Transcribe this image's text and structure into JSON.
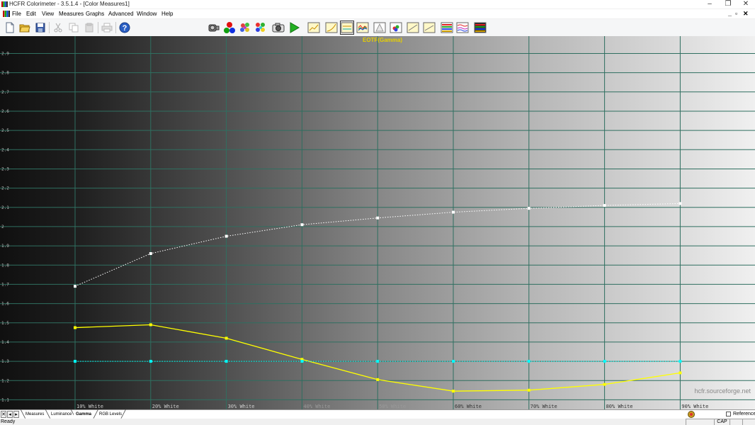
{
  "window": {
    "title": "HCFR Colorimeter - 3.5.1.4 - [Color Measures1]",
    "controls": {
      "minimize": "–",
      "restore": "❐",
      "close": "✕"
    }
  },
  "menu": {
    "items": [
      "File",
      "Edit",
      "View",
      "Measures",
      "Graphs",
      "Advanced",
      "Window",
      "Help"
    ],
    "mdi_controls": {
      "minimize": "_",
      "restore": "▫",
      "close": "✕"
    }
  },
  "toolbar": {
    "buttons": [
      {
        "name": "new-icon"
      },
      {
        "name": "open-icon"
      },
      {
        "name": "save-icon"
      },
      {
        "name": "cut-icon"
      },
      {
        "name": "copy-icon"
      },
      {
        "name": "paste-icon"
      },
      {
        "name": "print-icon"
      },
      {
        "name": "help-icon"
      },
      {
        "name": "sensor-icon"
      },
      {
        "name": "rgb-icon"
      },
      {
        "name": "color-checker-icon"
      },
      {
        "name": "palette-icon"
      },
      {
        "name": "camera-icon"
      },
      {
        "name": "play-icon"
      },
      {
        "name": "view-measures-icon"
      },
      {
        "name": "view-luminance-icon"
      },
      {
        "name": "view-gamma-icon"
      },
      {
        "name": "view-rgb-levels-icon"
      },
      {
        "name": "view-cie-icon"
      },
      {
        "name": "view-colortemp-icon"
      },
      {
        "name": "view-near-black-icon"
      },
      {
        "name": "view-near-white-icon"
      },
      {
        "name": "view-saturation-icon"
      },
      {
        "name": "view-sat-shift-icon"
      },
      {
        "name": "view-grayscale-icon"
      }
    ],
    "selected": "view-gamma-icon"
  },
  "chart_data": {
    "type": "line",
    "title": "EOTF(Gamma)",
    "ylim": [
      1.05,
      2.99
    ],
    "yticks": [
      "1.1",
      "1.2",
      "1.3",
      "1.4",
      "1.5",
      "1.6",
      "1.7",
      "1.8",
      "1.9",
      "2",
      "2.1",
      "2.2",
      "2.3",
      "2.4",
      "2.5",
      "2.6",
      "2.7",
      "2.8",
      "2.9"
    ],
    "categories": [
      "10% White",
      "20% White",
      "30% White",
      "40% White",
      "50% White",
      "60% White",
      "70% White",
      "80% White",
      "90% White"
    ],
    "series": [
      {
        "color": "#ffffff",
        "style": "dotted",
        "values": [
          1.69,
          1.86,
          1.95,
          2.01,
          2.045,
          2.075,
          2.095,
          2.11,
          2.12
        ]
      },
      {
        "color": "#ffff00",
        "style": "solid",
        "values": [
          1.475,
          1.49,
          1.42,
          1.31,
          1.205,
          1.145,
          1.15,
          1.18,
          1.24
        ]
      },
      {
        "color": "#00ffff",
        "style": "dotted",
        "values": [
          1.3,
          1.3,
          1.3,
          1.3,
          1.3,
          1.3,
          1.3,
          1.3,
          1.3
        ]
      }
    ],
    "grid": true,
    "background": "grayscale gradient (dark to light, left to right)",
    "watermark": "hcfr.sourceforge.net"
  },
  "tabs": {
    "items": [
      "Measures",
      "Luminance",
      "Gamma",
      "RGB Levels"
    ],
    "active": "Gamma",
    "reference_label": "Reference"
  },
  "status": {
    "text": "Ready",
    "indicator": "CAP"
  }
}
